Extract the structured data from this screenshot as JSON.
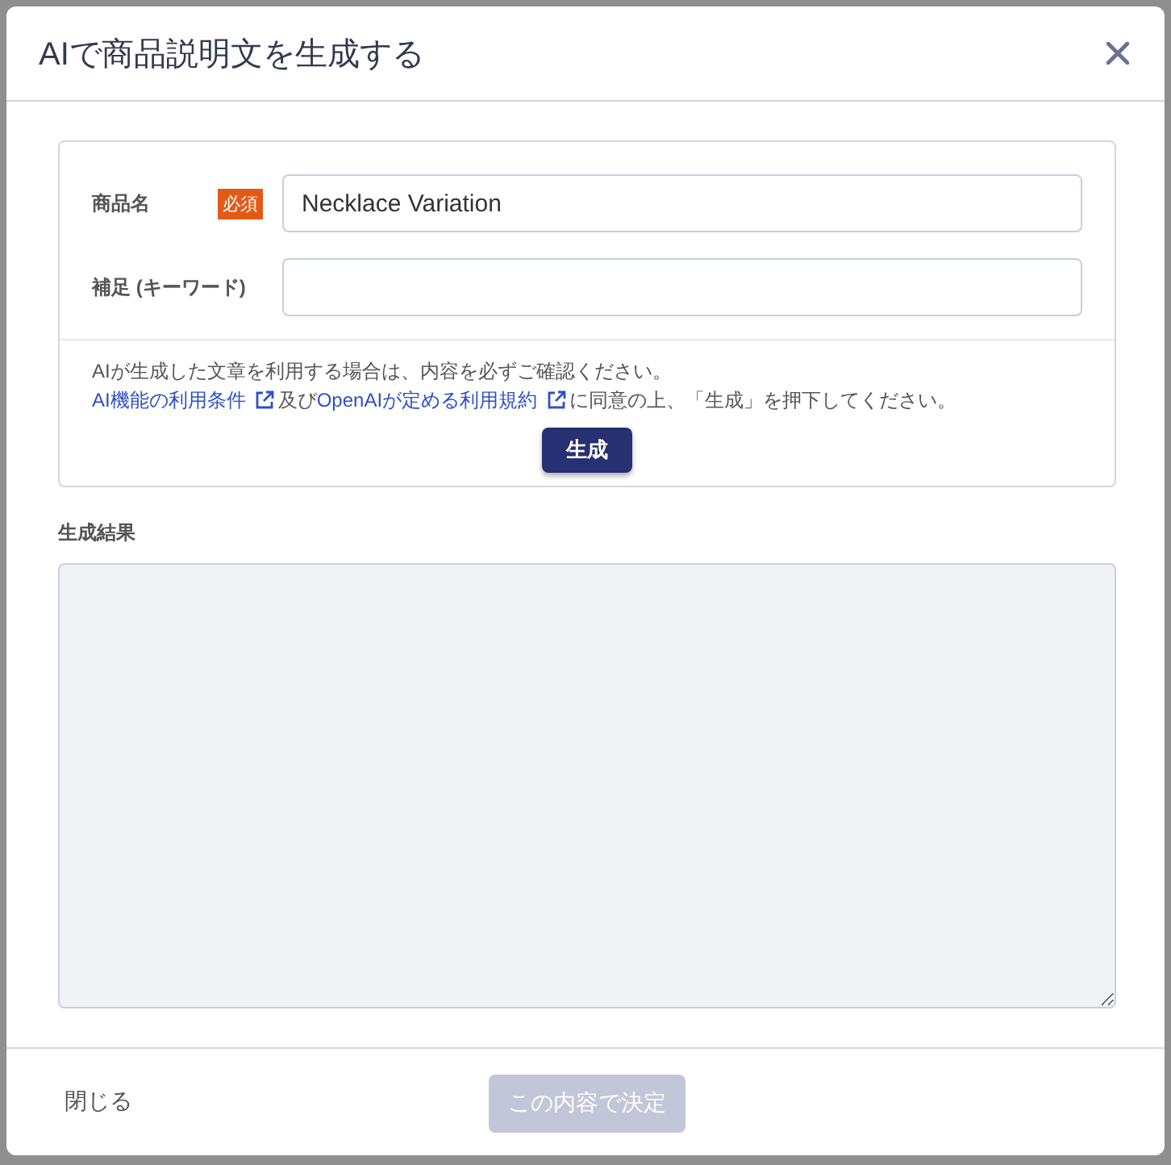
{
  "dialog": {
    "title": "AIで商品説明文を生成する"
  },
  "form": {
    "fields": [
      {
        "label": "商品名",
        "required": true,
        "required_label": "必須",
        "value": "Necklace Variation"
      },
      {
        "label": "補足 (キーワード)",
        "required": false
      }
    ],
    "notice": {
      "line1": "AIが生成した文章を利用する場合は、内容を必ずご確認ください。",
      "line2": [
        {
          "kind": "link",
          "text": "AI機能の利用条件"
        },
        {
          "kind": "text",
          "text": "及び"
        },
        {
          "kind": "link",
          "text": "OpenAIが定める利用規約"
        },
        {
          "kind": "text",
          "text": "に同意の上、「生成」を押下してください。"
        }
      ]
    },
    "generate_button": "生成"
  },
  "result": {
    "label": "生成結果"
  },
  "footer": {
    "close": "閉じる",
    "submit": {
      "label": "この内容で決定",
      "disabled": true
    }
  }
}
